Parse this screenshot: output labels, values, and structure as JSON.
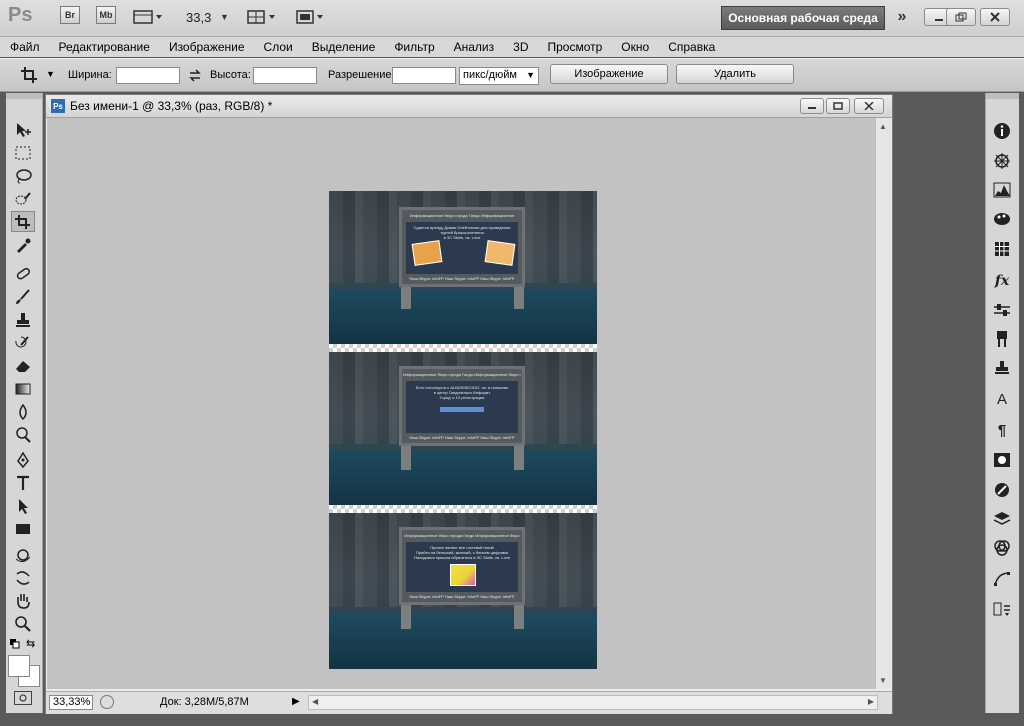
{
  "app": {
    "logo": "Ps"
  },
  "titlebar": {
    "br_label": "Br",
    "mb_label": "Mb",
    "zoom": "33,3",
    "workspace": "Основная рабочая среда",
    "more": "»"
  },
  "menu": [
    "Файл",
    "Редактирование",
    "Изображение",
    "Слои",
    "Выделение",
    "Фильтр",
    "Анализ",
    "3D",
    "Просмотр",
    "Окно",
    "Справка"
  ],
  "options": {
    "width_label": "Ширина:",
    "height_label": "Высота:",
    "resolution_label": "Разрешение:",
    "units": "пикс/дюйм",
    "image_button": "Изображение",
    "clear_button": "Удалить"
  },
  "document": {
    "title": "Без имени-1 @ 33,3% (раз, RGB/8) *",
    "badge": "Ps"
  },
  "status": {
    "zoom": "33,33%",
    "doc_size": "Док: 3,28M/5,87M"
  },
  "image_panels": [
    {
      "header": "Информационное бюро города Гандо   Информационное",
      "lines": [
        "Сдается аренду Домик Олейтсекан для проведения",
        "турней бракосочетания",
        "в ЗС Stolle, пк. Love"
      ],
      "footer": "Наш Skype: infoFP   Наш Skype: infoFP   Наш Skype: infoFP"
    },
    {
      "header": "Информационное бюро города Гандо   Информационное бюро г",
      "lines": [
        "Есть потолоуста с ALBARISKOOO. пн. в польские",
        "в центр Гандизельта Информт",
        "Город' и 10 регистрации"
      ],
      "footer": "Наш Skype: infoFP   Наш Skype: infoFP   Наш Skype: infoFP"
    },
    {
      "header": "Информационное бюро города Гандо   Информационное бюро",
      "lines": [
        "Прочее являет все гостевой гений",
        "Прийти на бельский, житский, с бельем цифрами",
        "Находимся пришла обратиться в ЗС Stolle, пк. Love"
      ],
      "footer": "Наш Skype: infoFP   Наш Skype: infoFP   Наш Skype: infoFP"
    }
  ]
}
